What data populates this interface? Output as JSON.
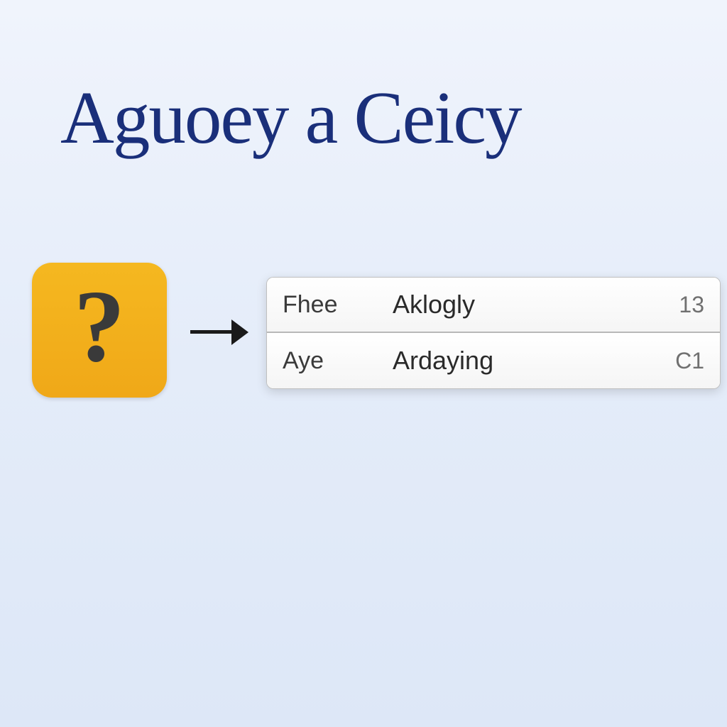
{
  "title": "Aguoey a Ceicy",
  "helpIcon": {
    "symbol": "?"
  },
  "panel": {
    "rows": [
      {
        "left": "Fhee",
        "mid": "Aklogly",
        "right": "13"
      },
      {
        "left": "Aye",
        "mid": "Ardaying",
        "right": "C1"
      }
    ]
  }
}
